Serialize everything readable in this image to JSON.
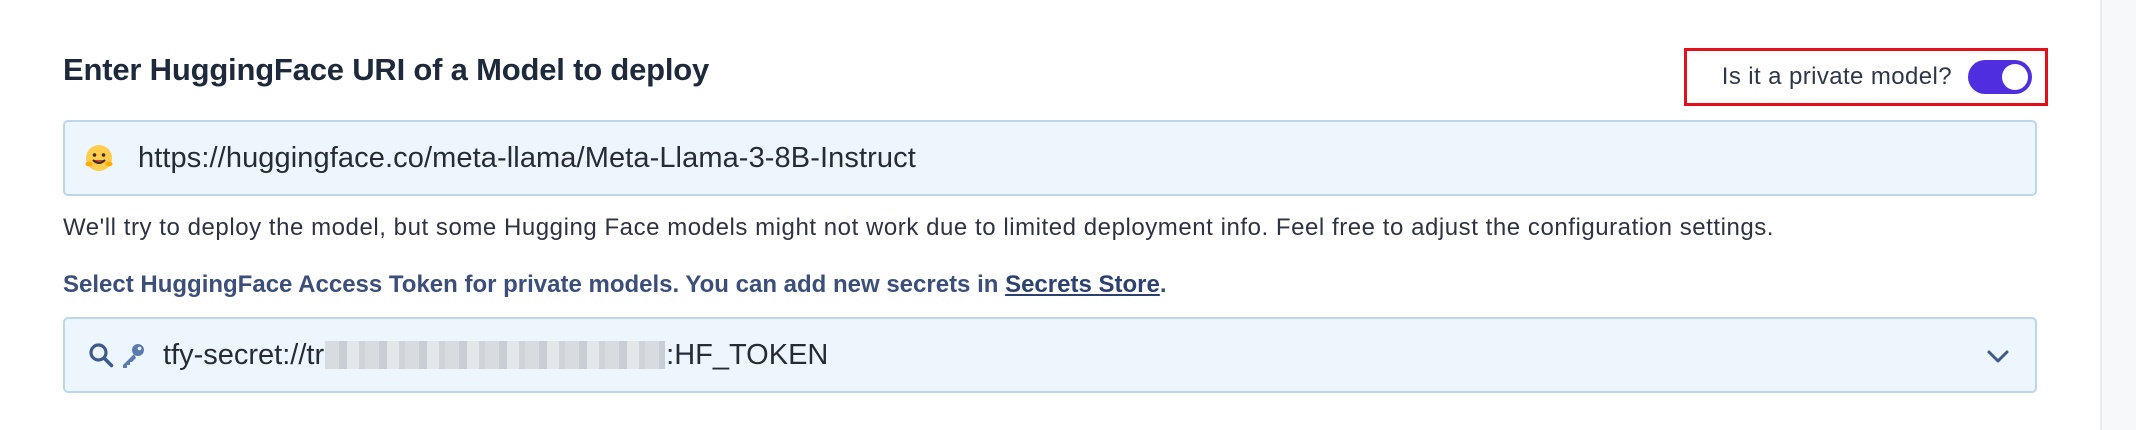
{
  "form": {
    "title": "Enter HuggingFace URI of a Model to deploy",
    "private_toggle": {
      "label": "Is it a private model?",
      "enabled": true
    },
    "uri_input": {
      "value": "https://huggingface.co/meta-llama/Meta-Llama-3-8B-Instruct",
      "icon": "hugging-face-icon"
    },
    "info_text": "We'll try to deploy the model, but some Hugging Face models might not work due to limited deployment info. Feel free to adjust the configuration settings.",
    "token_help": {
      "text": "Select HuggingFace Access Token for private models. You can add new secrets in ",
      "link": "Secrets Store",
      "suffix": "."
    },
    "secret_select": {
      "prefix": "tfy-secret://tr",
      "suffix": ":HF_TOKEN",
      "icons": [
        "search-icon",
        "key-icon",
        "chevron-down-icon"
      ]
    }
  },
  "colors": {
    "accent": "#4f2ee0",
    "highlight_box": "#e3101c",
    "field_bg": "#eef6fd",
    "field_border": "#bcd6ee",
    "help_text": "#3c4e7a"
  }
}
